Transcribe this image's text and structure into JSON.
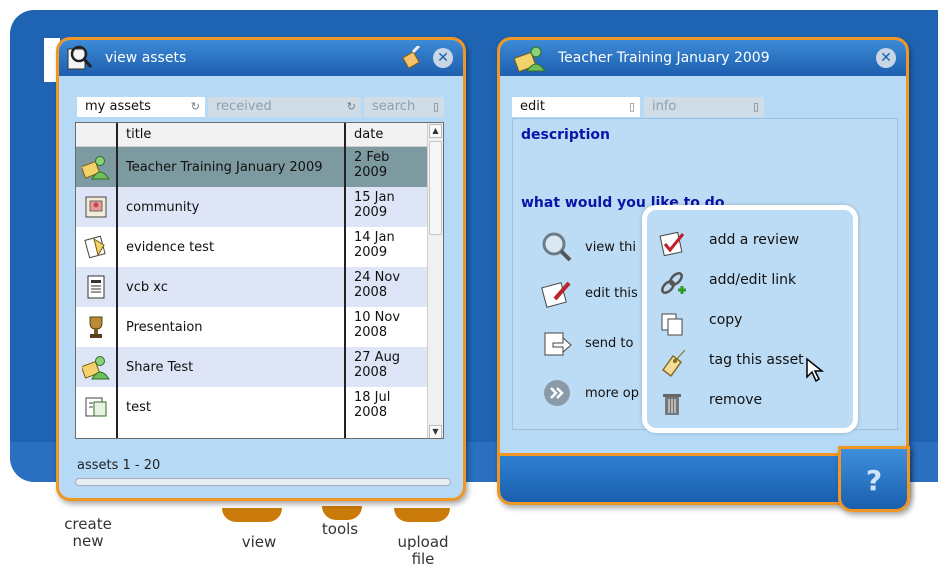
{
  "left_panel": {
    "title": "view assets",
    "tabs": [
      {
        "label": "my assets",
        "active": true
      },
      {
        "label": "received",
        "active": false
      },
      {
        "label": "search",
        "active": false
      }
    ],
    "columns": [
      "title",
      "date"
    ],
    "rows": [
      {
        "title": "Teacher Training January 2009",
        "date": "2 Feb 2009",
        "icon": "people-icon",
        "state": "selected"
      },
      {
        "title": "community",
        "date": "15 Jan 2009",
        "icon": "picture-icon",
        "state": "alt"
      },
      {
        "title": "evidence test",
        "date": "14 Jan 2009",
        "icon": "evidence-icon",
        "state": "plain"
      },
      {
        "title": "vcb xc",
        "date": "24 Nov 2008",
        "icon": "document-icon",
        "state": "alt"
      },
      {
        "title": "Presentaion",
        "date": "10 Nov 2008",
        "icon": "trophy-icon",
        "state": "plain"
      },
      {
        "title": "Share Test",
        "date": "27 Aug 2008",
        "icon": "people-icon",
        "state": "alt"
      },
      {
        "title": "test",
        "date": "18 Jul 2008",
        "icon": "presentation-icon",
        "state": "plain"
      }
    ],
    "footer": "assets 1 - 20"
  },
  "right_panel": {
    "title": "Teacher Training January 2009",
    "tabs": [
      {
        "label": "edit",
        "active": true
      },
      {
        "label": "info",
        "active": false
      }
    ],
    "description_heading": "description",
    "actions_heading": "what would you like to do",
    "actions": [
      "view thi",
      "edit this",
      "send to",
      "more op"
    ]
  },
  "popup_menu": {
    "items": [
      {
        "label": "add a review",
        "icon": "review-check-icon"
      },
      {
        "label": "add/edit link",
        "icon": "link-add-icon"
      },
      {
        "label": "copy",
        "icon": "copy-icon"
      },
      {
        "label": "tag this asset",
        "icon": "tag-icon"
      },
      {
        "label": "remove",
        "icon": "trash-icon"
      }
    ]
  },
  "dock": {
    "create_new": "create new",
    "view": "view",
    "tools": "tools",
    "upload_file": "upload file"
  },
  "help_label": "?",
  "colors": {
    "accent_orange": "#f09624",
    "header_blue": "#1c5fae",
    "panel_bg": "#b6daf6",
    "heading_blue": "#0a14a8",
    "selected_row": "#7c9aa0"
  }
}
